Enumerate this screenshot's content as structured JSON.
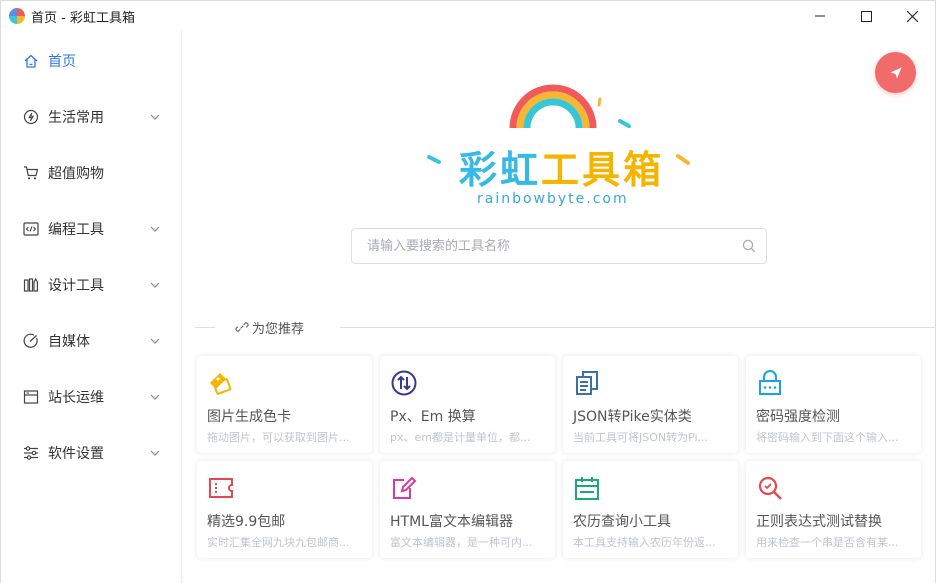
{
  "window": {
    "title": "首页 - 彩虹工具箱"
  },
  "sidebar": {
    "items": [
      {
        "label": "首页",
        "icon": "home-icon",
        "active": true
      },
      {
        "label": "生活常用",
        "icon": "fire-icon",
        "expandable": true
      },
      {
        "label": "超值购物",
        "icon": "cart-icon"
      },
      {
        "label": "编程工具",
        "icon": "code-icon",
        "expandable": true
      },
      {
        "label": "设计工具",
        "icon": "design-icon",
        "expandable": true
      },
      {
        "label": "自媒体",
        "icon": "media-icon",
        "expandable": true
      },
      {
        "label": "站长运维",
        "icon": "server-icon",
        "expandable": true
      },
      {
        "label": "软件设置",
        "icon": "sliders-icon",
        "expandable": true
      }
    ]
  },
  "logo": {
    "text": [
      "彩",
      "虹",
      "工",
      "具",
      "箱"
    ],
    "subtitle": "rainbowbyte.com"
  },
  "search": {
    "placeholder": "请输入要搜索的工具名称",
    "value": ""
  },
  "recommend": {
    "label": "为您推荐"
  },
  "cards": [
    {
      "title": "图片生成色卡",
      "desc": "拖动图片，可以获取到图片...",
      "icon": "color-card-icon",
      "color": "#f5b400"
    },
    {
      "title": "Px、Em 换算",
      "desc": "px、em都是计量单位，都...",
      "icon": "convert-icon",
      "color": "#3a3a8c"
    },
    {
      "title": "JSON转Pike实体类",
      "desc": "当前工具可将JSON转为Pi...",
      "icon": "copy-icon",
      "color": "#3b6fa8"
    },
    {
      "title": "密码强度检测",
      "desc": "将密码输入到下面这个输入...",
      "icon": "lock-icon",
      "color": "#1aa3e8"
    },
    {
      "title": "精选9.9包邮",
      "desc": "实时汇集全网九块九包邮商...",
      "icon": "ticket-icon",
      "color": "#e5484d"
    },
    {
      "title": "HTML富文本编辑器",
      "desc": "富文本编辑器，是一种可内...",
      "icon": "edit-icon",
      "color": "#d63aa6"
    },
    {
      "title": "农历查询小工具",
      "desc": "本工具支持输入农历年份返...",
      "icon": "calendar-icon",
      "color": "#19a97b"
    },
    {
      "title": "正则表达式测试替换",
      "desc": "用来检查一个串是否含有某...",
      "icon": "regex-search-icon",
      "color": "#e5484d"
    }
  ],
  "colors": {
    "accent": "#2b7ae4",
    "fab": "#f26b6b"
  }
}
